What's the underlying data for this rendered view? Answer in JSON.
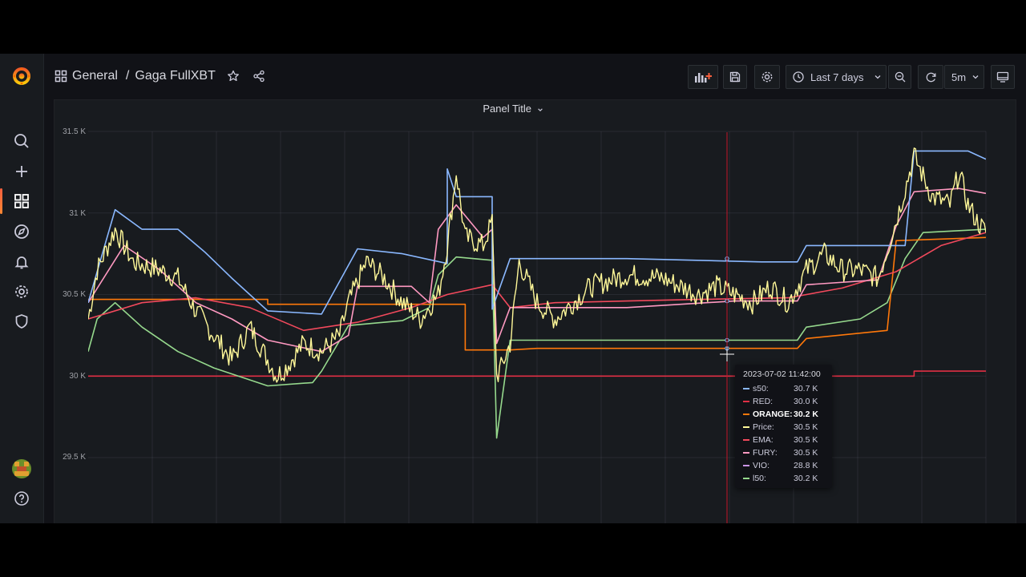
{
  "breadcrumb": {
    "folder": "General",
    "dashboard": "Gaga FullXBT"
  },
  "toolbar": {
    "time_range": "Last 7 days",
    "refresh_interval": "5m"
  },
  "panel": {
    "title": "Panel Title"
  },
  "sidebar": {
    "icons": [
      "grafana-logo-icon",
      "search-icon",
      "plus-icon",
      "dashboards-icon",
      "compass-icon",
      "bell-icon",
      "gear-icon",
      "shield-icon",
      "avatar",
      "help-icon"
    ]
  },
  "colors": {
    "s50": "#8ab8ff",
    "RED": "#e02f44",
    "ORANGE": "#ff780a",
    "Price": "#fff899",
    "EMA": "#f2495c",
    "FURY": "#ff99c1",
    "VIO": "#ca95e5",
    "l50": "#96d98d",
    "crosshair": "#c4162a",
    "accent": "#f55f3e"
  },
  "tooltip": {
    "time": "2023-07-02 11:42:00",
    "rows": [
      {
        "name": "s50:",
        "value": "30.7 K",
        "color": "#8ab8ff",
        "bold": false
      },
      {
        "name": "RED:",
        "value": "30.0 K",
        "color": "#e02f44",
        "bold": false
      },
      {
        "name": "ORANGE:",
        "value": "30.2 K",
        "color": "#ff780a",
        "bold": true
      },
      {
        "name": "Price:",
        "value": "30.5 K",
        "color": "#fff899",
        "bold": false
      },
      {
        "name": "EMA:",
        "value": "30.5 K",
        "color": "#f2495c",
        "bold": false
      },
      {
        "name": "FURY:",
        "value": "30.5 K",
        "color": "#ff99c1",
        "bold": false
      },
      {
        "name": "VIO:",
        "value": "28.8 K",
        "color": "#ca95e5",
        "bold": false
      },
      {
        "name": "l50:",
        "value": "30.2 K",
        "color": "#96d98d",
        "bold": false
      }
    ]
  },
  "chart_data": {
    "type": "line",
    "title": "Panel Title",
    "y_tick_labels": [
      "31.5 K",
      "31 K",
      "30.5 K",
      "30 K",
      "29.5 K"
    ],
    "ylim": [
      29300,
      31550
    ],
    "grid": true,
    "x_range": "Last 7 days",
    "series": [
      {
        "name": "s50",
        "color": "#8ab8ff",
        "values": [
          [
            0,
            30450
          ],
          [
            0.03,
            31020
          ],
          [
            0.06,
            30900
          ],
          [
            0.1,
            30900
          ],
          [
            0.13,
            30760
          ],
          [
            0.16,
            30600
          ],
          [
            0.2,
            30400
          ],
          [
            0.26,
            30380
          ],
          [
            0.3,
            30780
          ],
          [
            0.35,
            30750
          ],
          [
            0.4,
            30690
          ],
          [
            0.4,
            31270
          ],
          [
            0.41,
            31100
          ],
          [
            0.45,
            31100
          ],
          [
            0.45,
            30410
          ],
          [
            0.47,
            30720
          ],
          [
            0.6,
            30720
          ],
          [
            0.75,
            30700
          ],
          [
            0.79,
            30700
          ],
          [
            0.8,
            30800
          ],
          [
            0.88,
            30800
          ],
          [
            0.91,
            30800
          ],
          [
            0.92,
            31380
          ],
          [
            0.98,
            31380
          ],
          [
            1.0,
            31330
          ]
        ]
      },
      {
        "name": "RED",
        "color": "#e02f44",
        "values": [
          [
            0,
            30000
          ],
          [
            0.92,
            30000
          ],
          [
            0.92,
            30030
          ],
          [
            1.0,
            30030
          ]
        ]
      },
      {
        "name": "ORANGE",
        "color": "#ff780a",
        "values": [
          [
            0,
            30470
          ],
          [
            0.2,
            30470
          ],
          [
            0.2,
            30440
          ],
          [
            0.42,
            30440
          ],
          [
            0.42,
            30160
          ],
          [
            0.47,
            30160
          ],
          [
            0.5,
            30170
          ],
          [
            0.79,
            30170
          ],
          [
            0.8,
            30230
          ],
          [
            0.89,
            30280
          ],
          [
            0.9,
            30830
          ],
          [
            1.0,
            30850
          ]
        ]
      },
      {
        "name": "Price",
        "color": "#fff899",
        "values": [
          [
            0,
            30350
          ],
          [
            0.01,
            30650
          ],
          [
            0.03,
            30900
          ],
          [
            0.05,
            30700
          ],
          [
            0.08,
            30650
          ],
          [
            0.1,
            30600
          ],
          [
            0.12,
            30400
          ],
          [
            0.14,
            30250
          ],
          [
            0.16,
            30100
          ],
          [
            0.18,
            30300
          ],
          [
            0.2,
            30100
          ],
          [
            0.21,
            30000
          ],
          [
            0.22,
            30050
          ],
          [
            0.24,
            30200
          ],
          [
            0.26,
            30150
          ],
          [
            0.28,
            30250
          ],
          [
            0.29,
            30450
          ],
          [
            0.31,
            30700
          ],
          [
            0.33,
            30600
          ],
          [
            0.35,
            30450
          ],
          [
            0.37,
            30350
          ],
          [
            0.39,
            30500
          ],
          [
            0.4,
            30800
          ],
          [
            0.41,
            31250
          ],
          [
            0.42,
            30850
          ],
          [
            0.44,
            30800
          ],
          [
            0.45,
            30950
          ],
          [
            0.455,
            30000
          ],
          [
            0.46,
            30050
          ],
          [
            0.47,
            30200
          ],
          [
            0.48,
            30700
          ],
          [
            0.5,
            30450
          ],
          [
            0.52,
            30350
          ],
          [
            0.54,
            30450
          ],
          [
            0.56,
            30550
          ],
          [
            0.6,
            30620
          ],
          [
            0.64,
            30600
          ],
          [
            0.68,
            30500
          ],
          [
            0.7,
            30550
          ],
          [
            0.72,
            30500
          ],
          [
            0.74,
            30450
          ],
          [
            0.76,
            30550
          ],
          [
            0.78,
            30450
          ],
          [
            0.8,
            30650
          ],
          [
            0.82,
            30750
          ],
          [
            0.84,
            30650
          ],
          [
            0.86,
            30650
          ],
          [
            0.88,
            30600
          ],
          [
            0.9,
            30950
          ],
          [
            0.92,
            31350
          ],
          [
            0.94,
            31100
          ],
          [
            0.96,
            31050
          ],
          [
            0.97,
            31250
          ],
          [
            0.98,
            31050
          ],
          [
            0.99,
            30950
          ],
          [
            1.0,
            30880
          ]
        ]
      },
      {
        "name": "EMA",
        "color": "#f2495c",
        "values": [
          [
            0,
            30350
          ],
          [
            0.06,
            30450
          ],
          [
            0.12,
            30480
          ],
          [
            0.18,
            30420
          ],
          [
            0.24,
            30280
          ],
          [
            0.3,
            30330
          ],
          [
            0.36,
            30420
          ],
          [
            0.4,
            30500
          ],
          [
            0.45,
            30560
          ],
          [
            0.47,
            30420
          ],
          [
            0.52,
            30450
          ],
          [
            0.6,
            30460
          ],
          [
            0.68,
            30470
          ],
          [
            0.78,
            30480
          ],
          [
            0.84,
            30540
          ],
          [
            0.9,
            30640
          ],
          [
            0.95,
            30800
          ],
          [
            1.0,
            30880
          ]
        ]
      },
      {
        "name": "FURY",
        "color": "#ff99c1",
        "values": [
          [
            0,
            30450
          ],
          [
            0.04,
            30800
          ],
          [
            0.08,
            30650
          ],
          [
            0.12,
            30450
          ],
          [
            0.16,
            30350
          ],
          [
            0.2,
            30220
          ],
          [
            0.26,
            30150
          ],
          [
            0.29,
            30250
          ],
          [
            0.3,
            30550
          ],
          [
            0.36,
            30550
          ],
          [
            0.38,
            30450
          ],
          [
            0.39,
            30900
          ],
          [
            0.41,
            31050
          ],
          [
            0.44,
            30850
          ],
          [
            0.45,
            30900
          ],
          [
            0.455,
            30200
          ],
          [
            0.47,
            30420
          ],
          [
            0.6,
            30420
          ],
          [
            0.72,
            30460
          ],
          [
            0.79,
            30460
          ],
          [
            0.8,
            30560
          ],
          [
            0.88,
            30590
          ],
          [
            0.9,
            30920
          ],
          [
            0.92,
            31130
          ],
          [
            0.97,
            31150
          ],
          [
            1.0,
            31120
          ]
        ]
      },
      {
        "name": "l50",
        "color": "#96d98d",
        "values": [
          [
            0,
            30150
          ],
          [
            0.01,
            30350
          ],
          [
            0.03,
            30450
          ],
          [
            0.06,
            30300
          ],
          [
            0.1,
            30150
          ],
          [
            0.14,
            30050
          ],
          [
            0.2,
            29940
          ],
          [
            0.25,
            29960
          ],
          [
            0.26,
            30030
          ],
          [
            0.29,
            30310
          ],
          [
            0.35,
            30340
          ],
          [
            0.38,
            30420
          ],
          [
            0.39,
            30620
          ],
          [
            0.41,
            30730
          ],
          [
            0.45,
            30710
          ],
          [
            0.455,
            29620
          ],
          [
            0.47,
            30220
          ],
          [
            0.6,
            30220
          ],
          [
            0.75,
            30220
          ],
          [
            0.79,
            30220
          ],
          [
            0.8,
            30300
          ],
          [
            0.86,
            30350
          ],
          [
            0.89,
            30450
          ],
          [
            0.91,
            30720
          ],
          [
            0.93,
            30880
          ],
          [
            1.0,
            30900
          ]
        ]
      }
    ],
    "x_unit": "fraction of visible range"
  }
}
